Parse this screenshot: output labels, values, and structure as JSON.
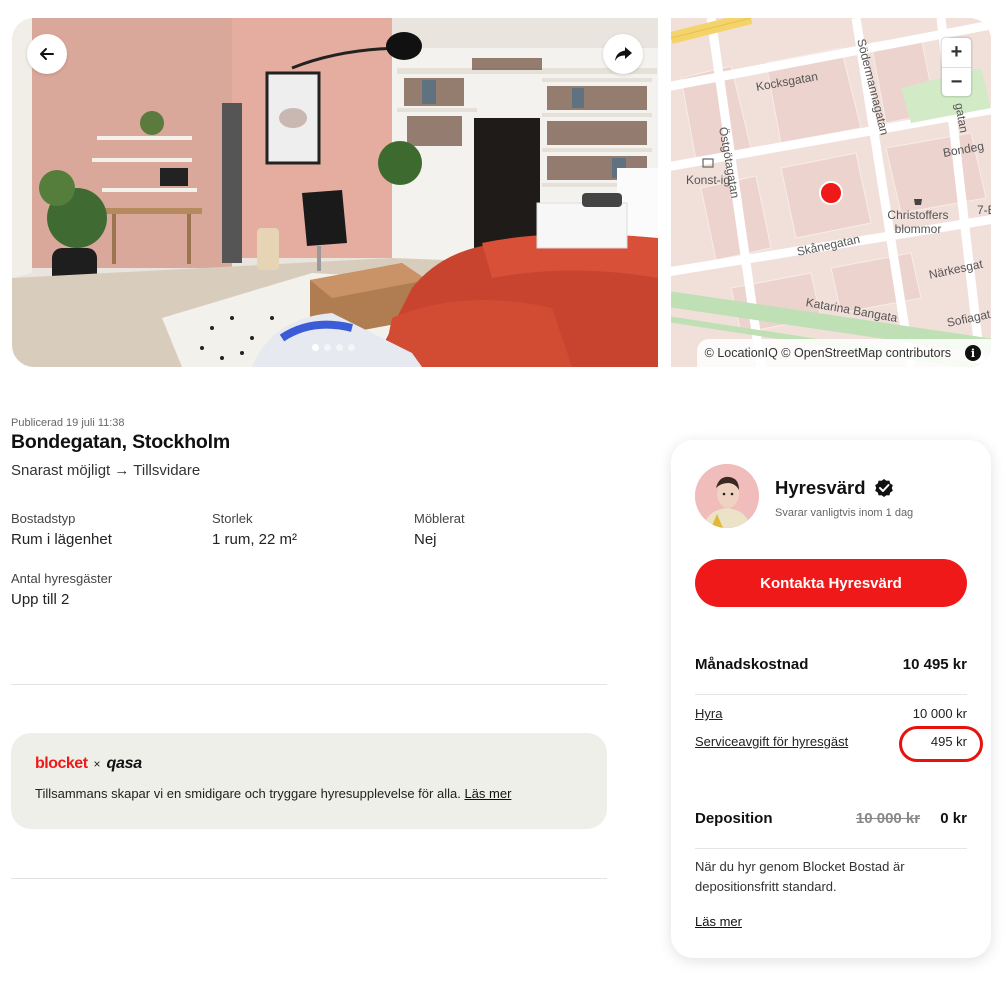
{
  "gallery": {
    "back_icon": "arrow-left-icon",
    "share_icon": "share-arrow-icon",
    "slides": 4,
    "active_slide": 1
  },
  "map": {
    "streets": [
      "Kocksgatan",
      "Södermannagatan",
      "Östgötagatan",
      "Bondeg",
      "Skånegatan",
      "Katarina Bangata",
      "Närkesgat",
      "Sofiagat",
      "gatan"
    ],
    "pois": [
      "Konst-ig",
      "Christoffers blommor",
      "7-E"
    ],
    "zoom_in": "+",
    "zoom_out": "−",
    "attribution": "© LocationIQ © OpenStreetMap contributors",
    "info": "i",
    "marker_color": "#f01919"
  },
  "listing": {
    "published": "Publicerad 19 juli 11:38",
    "title": "Bondegatan, Stockholm",
    "dates": "Snarast möjligt → Tillsvidare",
    "specs": {
      "type": {
        "label": "Bostadstyp",
        "value": "Rum i lägenhet"
      },
      "size": {
        "label": "Storlek",
        "value": "1 rum, 22 m²"
      },
      "furnished": {
        "label": "Möblerat",
        "value": "Nej"
      },
      "tenants": {
        "label": "Antal hyresgäster",
        "value": "Upp till 2"
      }
    }
  },
  "promo": {
    "brand_blocket": "blocket",
    "brand_x": "×",
    "brand_qasa": "qasa",
    "text": "Tillsammans skapar vi en smidigare och tryggare hyresupplevelse för alla.",
    "link": "Läs mer"
  },
  "card": {
    "host_name": "Hyresvärd",
    "verified_icon": "verified-badge-icon",
    "response": "Svarar vanligtvis inom 1 dag",
    "contact_button": "Kontakta Hyresvärd",
    "monthly_label": "Månadskostnad",
    "monthly_value": "10 495 kr",
    "rent_label": "Hyra",
    "rent_value": "10 000 kr",
    "fee_label": "Serviceavgift för hyresgäst",
    "fee_value": "495 kr",
    "deposit_label": "Deposition",
    "deposit_old": "10 000 kr",
    "deposit_value": "0 kr",
    "deposit_note": "När du hyr genom Blocket Bostad är depositionsfritt standard.",
    "read_more": "Läs mer"
  },
  "colors": {
    "accent_red": "#f01919",
    "highlight_ring": "#e8120c",
    "promo_bg": "#efefe9"
  }
}
